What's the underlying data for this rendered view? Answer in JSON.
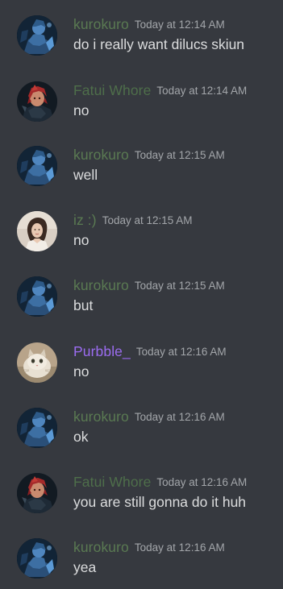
{
  "colors": {
    "background": "#36393f",
    "timestamp": "#a3a6aa",
    "message_text": "#dcddde"
  },
  "messages": [
    {
      "author": "kurokuro",
      "author_color": "#5a7a52",
      "avatar": "blue-armored-character-avatar",
      "time": "Today at 12:14 AM",
      "text": "do i really want dilucs skiun"
    },
    {
      "author": "Fatui Whore",
      "author_color": "#4e6e4a",
      "avatar": "red-haired-character-avatar",
      "time": "Today at 12:14 AM",
      "text": "no"
    },
    {
      "author": "kurokuro",
      "author_color": "#5a7a52",
      "avatar": "blue-armored-character-avatar",
      "time": "Today at 12:15 AM",
      "text": "well"
    },
    {
      "author": "iz :)",
      "author_color": "#5a7a52",
      "avatar": "woman-portrait-avatar",
      "time": "Today at 12:15 AM",
      "text": "no"
    },
    {
      "author": "kurokuro",
      "author_color": "#5a7a52",
      "avatar": "blue-armored-character-avatar",
      "time": "Today at 12:15 AM",
      "text": "but"
    },
    {
      "author": "Purbble_",
      "author_color": "#9b6cf0",
      "avatar": "cat-photo-avatar",
      "time": "Today at 12:16 AM",
      "text": "no"
    },
    {
      "author": "kurokuro",
      "author_color": "#5a7a52",
      "avatar": "blue-armored-character-avatar",
      "time": "Today at 12:16 AM",
      "text": "ok"
    },
    {
      "author": "Fatui Whore",
      "author_color": "#4e6e4a",
      "avatar": "red-haired-character-avatar",
      "time": "Today at 12:16 AM",
      "text": "you are still gonna do it huh"
    },
    {
      "author": "kurokuro",
      "author_color": "#5a7a52",
      "avatar": "blue-armored-character-avatar",
      "time": "Today at 12:16 AM",
      "text": "yea"
    }
  ]
}
